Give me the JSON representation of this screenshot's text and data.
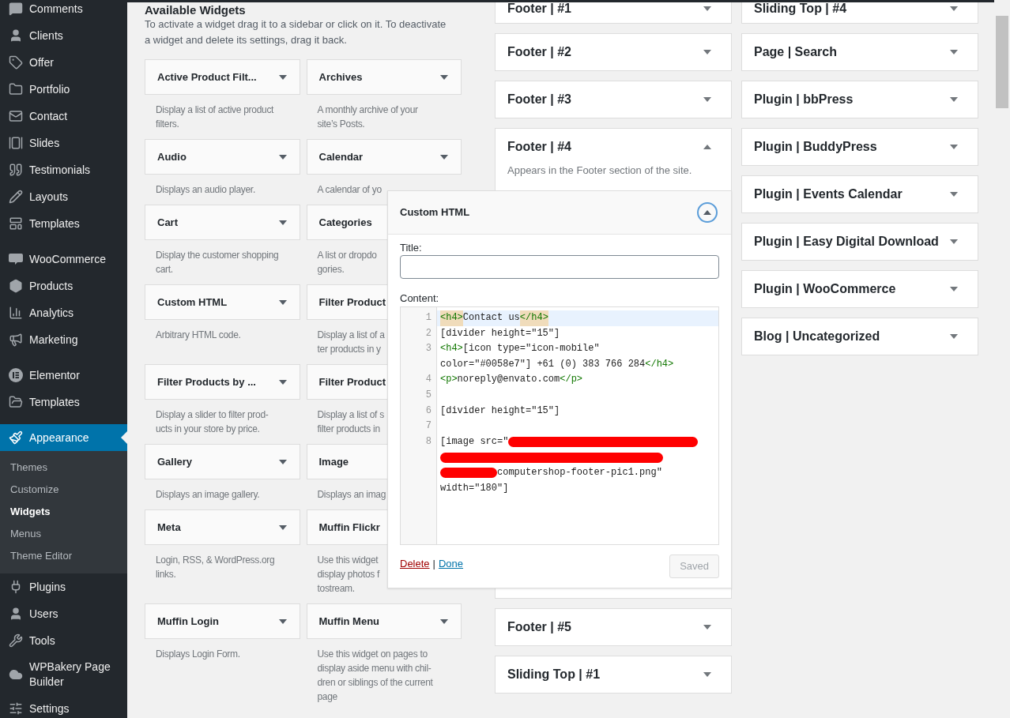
{
  "sidebar": {
    "groups": [
      {
        "items": [
          {
            "label": "Comments",
            "selected": false
          },
          {
            "label": "Clients",
            "selected": false
          },
          {
            "label": "Offer",
            "selected": false
          },
          {
            "label": "Portfolio",
            "selected": false
          },
          {
            "label": "Contact",
            "selected": false
          },
          {
            "label": "Slides",
            "selected": false
          },
          {
            "label": "Testimonials",
            "selected": false
          },
          {
            "label": "Layouts",
            "selected": false
          },
          {
            "label": "Templates",
            "selected": false
          }
        ]
      },
      {
        "items": [
          {
            "label": "WooCommerce",
            "selected": false
          },
          {
            "label": "Products",
            "selected": false
          },
          {
            "label": "Analytics",
            "selected": false
          },
          {
            "label": "Marketing",
            "selected": false
          }
        ]
      },
      {
        "items": [
          {
            "label": "Elementor",
            "selected": false
          },
          {
            "label": "Templates",
            "selected": false
          }
        ]
      },
      {
        "items": [
          {
            "label": "Appearance",
            "selected": true,
            "submenu": [
              {
                "label": "Themes",
                "selected": false
              },
              {
                "label": "Customize",
                "selected": false
              },
              {
                "label": "Widgets",
                "selected": true
              },
              {
                "label": "Menus",
                "selected": false
              },
              {
                "label": "Theme Editor",
                "selected": false
              }
            ]
          },
          {
            "label": "Plugins",
            "selected": false
          },
          {
            "label": "Users",
            "selected": false
          },
          {
            "label": "Tools",
            "selected": false
          },
          {
            "label": "WPBakery Page Builder",
            "selected": false
          },
          {
            "label": "Settings",
            "selected": false
          }
        ]
      }
    ]
  },
  "available_widgets": {
    "heading": "Available Widgets",
    "description": "To activate a widget drag it to a sidebar or click on it. To deactivate a widget and delete its settings, drag it back.",
    "items": [
      {
        "title": "Active Product Filt...",
        "arrow": true,
        "description": [
          "Display a list of active product",
          "filters."
        ]
      },
      {
        "title": "Archives",
        "arrow": true,
        "description": [
          "A monthly archive of your",
          "site’s Posts."
        ]
      },
      {
        "title": "Audio",
        "arrow": true,
        "description": [
          "Displays an audio player."
        ]
      },
      {
        "title": "Calendar",
        "arrow": true,
        "description": [
          "A calendar of yo"
        ]
      },
      {
        "title": "Cart",
        "arrow": true,
        "description": [
          "Display the customer shopping",
          "cart."
        ]
      },
      {
        "title": "Categories",
        "arrow": false,
        "description": [
          "A list or dropdo",
          "gories."
        ]
      },
      {
        "title": "Custom HTML",
        "arrow": true,
        "description": [
          "Arbitrary HTML code."
        ]
      },
      {
        "title": "Filter Product",
        "arrow": false,
        "description": [
          "Display a list of a",
          "ter products in y"
        ]
      },
      {
        "title": "Filter Products by ...",
        "arrow": true,
        "description": [
          "Display a slider to filter prod-",
          "ucts in your store by price."
        ]
      },
      {
        "title": "Filter Product",
        "arrow": false,
        "description": [
          "Display a list of s",
          "filter products in"
        ]
      },
      {
        "title": "Gallery",
        "arrow": true,
        "description": [
          "Displays an image gallery."
        ]
      },
      {
        "title": "Image",
        "arrow": false,
        "description": [
          "Displays an imag"
        ]
      },
      {
        "title": "Meta",
        "arrow": true,
        "description": [
          "Login, RSS, & WordPress.org",
          "links."
        ]
      },
      {
        "title": "Muffin Flickr",
        "arrow": false,
        "description": [
          "Use this widget",
          "display photos f",
          "tostream."
        ]
      },
      {
        "title": "Muffin Login",
        "arrow": true,
        "description": [
          "Displays Login Form."
        ]
      },
      {
        "title": "Muffin Menu",
        "arrow": true,
        "description": [
          "Use this widget on pages to",
          "display aside menu with chil-",
          "dren or siblings of the current",
          "page"
        ]
      }
    ]
  },
  "sidebars_middle": [
    {
      "title": "Footer | #1",
      "expanded": false
    },
    {
      "title": "Footer | #2",
      "expanded": false
    },
    {
      "title": "Footer | #3",
      "expanded": false
    },
    {
      "title": "Footer | #4",
      "expanded": true,
      "description": "Appears in the Footer section of the site."
    },
    {
      "title": "Footer | #5",
      "expanded": false
    },
    {
      "title": "Sliding Top | #1",
      "expanded": false
    }
  ],
  "sidebars_right": [
    {
      "title": "Sliding Top | #4",
      "expanded": false
    },
    {
      "title": "Page | Search",
      "expanded": false
    },
    {
      "title": "Plugin | bbPress",
      "expanded": false
    },
    {
      "title": "Plugin | BuddyPress",
      "expanded": false
    },
    {
      "title": "Plugin | Events Calendar",
      "expanded": false
    },
    {
      "title": "Plugin | Easy Digital Download",
      "expanded": false
    },
    {
      "title": "Plugin | WooCommerce",
      "expanded": false
    },
    {
      "title": "Blog | Uncategorized",
      "expanded": false
    }
  ],
  "custom_html_widget": {
    "title": "Custom HTML",
    "expanded": true,
    "title_label": "Title:",
    "content_label": "Content:",
    "code_lines": [
      {
        "number": "1",
        "active": true,
        "rows": [
          {
            "segments": [
              {
                "kind": "tag",
                "text": "<h4>",
                "matched": true
              },
              {
                "kind": "text",
                "text": "Contact us"
              },
              {
                "kind": "tag",
                "text": "</h4>",
                "matched": true
              }
            ]
          }
        ]
      },
      {
        "number": "2",
        "active": false,
        "rows": [
          {
            "segments": [
              {
                "kind": "text",
                "text": "[divider height=\"15\"]"
              }
            ]
          }
        ]
      },
      {
        "number": "3",
        "active": false,
        "rows": [
          {
            "segments": [
              {
                "kind": "tag",
                "text": "<h4>",
                "matched": false
              },
              {
                "kind": "text",
                "text": "[icon type=\"icon-mobile\""
              }
            ]
          },
          {
            "segments": [
              {
                "kind": "text",
                "text": "color=\"#0058e7\"] +61 (0) 383 766 284"
              },
              {
                "kind": "tag",
                "text": "</h4>",
                "matched": false
              }
            ]
          }
        ]
      },
      {
        "number": "4",
        "active": false,
        "rows": [
          {
            "segments": [
              {
                "kind": "tag",
                "text": "<p>",
                "matched": false
              },
              {
                "kind": "text",
                "text": "noreply@envato.com"
              },
              {
                "kind": "tag",
                "text": "</p>",
                "matched": false
              }
            ]
          }
        ]
      },
      {
        "number": "5",
        "active": false
      },
      {
        "number": "6",
        "active": false,
        "rows": [
          {
            "segments": [
              {
                "kind": "text",
                "text": "[divider height=\"15\"]"
              }
            ]
          }
        ]
      },
      {
        "number": "7",
        "active": false
      },
      {
        "number": "8",
        "active": false,
        "rows": [
          {
            "segments": [
              {
                "kind": "text",
                "text": "[image src=\""
              },
              {
                "kind": "redacted"
              }
            ]
          },
          {
            "segments": [
              {
                "kind": "redacted"
              }
            ]
          },
          {
            "segments": [
              {
                "kind": "redacted"
              },
              {
                "kind": "text",
                "text": "computershop-footer-pic1.png\""
              }
            ]
          },
          {
            "segments": [
              {
                "kind": "text",
                "text": "width=\"180\"]"
              }
            ]
          }
        ]
      }
    ],
    "delete_link": "Delete",
    "separator": "|",
    "done_link": "Done",
    "save_button": {
      "label": "Saved",
      "disabled": true
    }
  }
}
